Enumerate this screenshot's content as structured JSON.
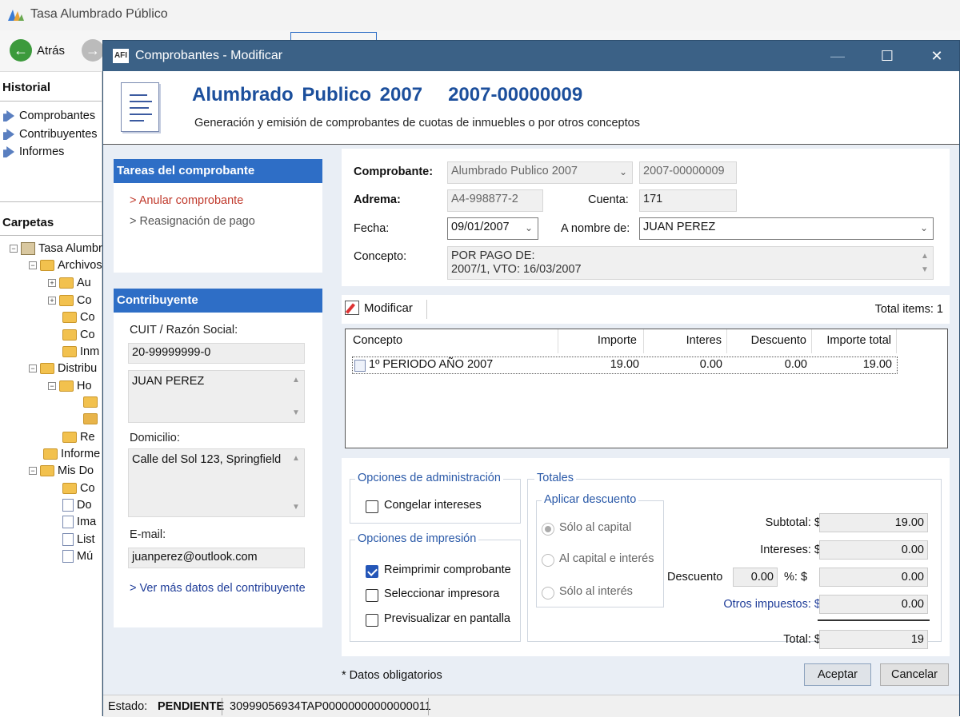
{
  "app": {
    "title": "Tasa Alumbrado Público",
    "back_label": "Atrás",
    "historial_title": "Historial",
    "historial_items": [
      "Comprobantes",
      "Contribuyentes",
      "Informes"
    ],
    "carpetas_title": "Carpetas",
    "tree": [
      "Tasa Alumbrado",
      "Archivos",
      "Au",
      "Co",
      "Co",
      "Co",
      "Inm",
      "Distribu",
      "Ho",
      "",
      "",
      "Re",
      "Informe",
      "Mis Do",
      "Co",
      "Do",
      "Ima",
      "List",
      "Mú"
    ]
  },
  "dialog": {
    "title": "Comprobantes - Modificar",
    "header_title": "Alumbrado Publico 2007   2007-00000009",
    "header_subtitle": "Generación y emisión de comprobantes de cuotas de inmuebles o por otros conceptos",
    "tasks": {
      "title": "Tareas del comprobante",
      "anular": "> Anular comprobante",
      "reasignacion": "> Reasignación de pago"
    },
    "contribuyente": {
      "title": "Contribuyente",
      "cuit_label": "CUIT / Razón Social:",
      "cuit": "20-99999999-0",
      "razon_social": "JUAN PEREZ",
      "domicilio_label": "Domicilio:",
      "domicilio": "Calle del Sol 123, Springfield",
      "email_label": "E-mail:",
      "email": "juanperez@outlook.com",
      "mas_datos": "> Ver más datos del contribuyente"
    },
    "form": {
      "comprobante_label": "Comprobante:",
      "comprobante_value": "Alumbrado Publico 2007",
      "comprobante_num": "2007-00000009",
      "adrema_label": "Adrema:",
      "adrema_value": "A4-998877-2",
      "cuenta_label": "Cuenta:",
      "cuenta_value": "171",
      "fecha_label": "Fecha:",
      "fecha_value": "09/01/2007",
      "nombre_label": "A nombre de:",
      "nombre_value": "JUAN PEREZ",
      "concepto_label": "Concepto:",
      "concepto_line1": "POR PAGO DE:",
      "concepto_line2": "2007/1, VTO: 16/03/2007"
    },
    "toolbar": {
      "modificar_label": "Modificar",
      "total_items": "Total items: 1"
    },
    "grid": {
      "headers": [
        "Concepto",
        "Importe",
        "Interes",
        "Descuento",
        "Importe total"
      ],
      "rows": [
        [
          "1º PERIODO AÑO 2007",
          "19.00",
          "0.00",
          "0.00",
          "19.00"
        ]
      ]
    },
    "admin": {
      "title": "Opciones de administración",
      "congelar": "Congelar intereses",
      "congelar_checked": false
    },
    "impresion": {
      "title": "Opciones de impresión",
      "reimprimir": "Reimprimir comprobante",
      "reimprimir_checked": true,
      "seleccionar": "Seleccionar impresora",
      "previsualizar": "Previsualizar en pantalla"
    },
    "totales": {
      "title": "Totales",
      "descuento_group": "Aplicar descuento",
      "radio_capital": "Sólo al capital",
      "radio_capital_interes": "Al capital e interés",
      "radio_interes": "Sólo al interés",
      "subtotal_label": "Subtotal: $",
      "subtotal": "19.00",
      "intereses_label": "Intereses: $",
      "intereses": "0.00",
      "descuento_label": "Descuento",
      "descuento_pct": "0.00",
      "pct_label": "%: $",
      "descuento": "0.00",
      "otros_label": "Otros impuestos: $",
      "otros": "0.00",
      "total_label": "Total: $",
      "total": "19"
    },
    "footer": {
      "obligatorios": "* Datos obligatorios",
      "aceptar": "Aceptar",
      "cancelar": "Cancelar"
    },
    "status": {
      "estado_label": "Estado:",
      "estado": "PENDIENTE",
      "code": "30999056934TAP00000000000000011"
    }
  },
  "colors": {
    "titlebar": "#3b6186",
    "panel_header": "#2e6ec6",
    "header_title": "#1c4f9c",
    "link_red": "#c0392b",
    "link_blue": "#1f3d99"
  }
}
